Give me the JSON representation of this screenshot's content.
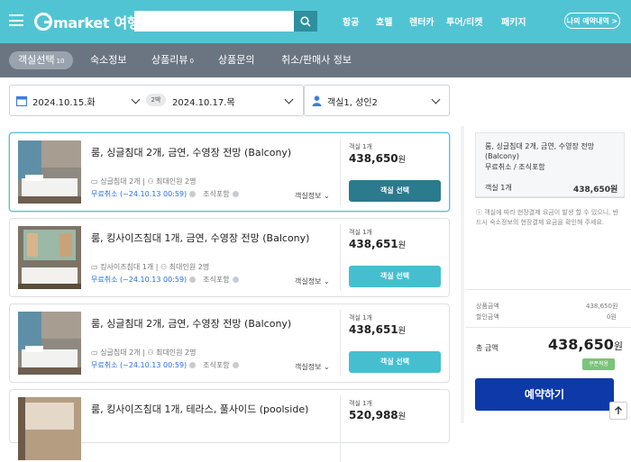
{
  "header": {
    "logo_text": "market 여행",
    "nav": [
      "항공",
      "호텔",
      "렌터카",
      "투어/티켓",
      "패키지"
    ],
    "my_button": "나의 예약내역 >"
  },
  "tabs": [
    {
      "label": "객실선택",
      "count": "10"
    },
    {
      "label": "숙소정보"
    },
    {
      "label": "상품리뷰",
      "count": "0"
    },
    {
      "label": "상품문의"
    },
    {
      "label": "취소/판매사 정보"
    }
  ],
  "filters": {
    "checkin": "2024.10.15.화",
    "nights": "2박",
    "checkout": "2024.10.17.목",
    "guests": "객실1, 성인2"
  },
  "rooms": [
    {
      "name": "룸, 싱글침대 2개, 금연, 수영장 전망 (Balcony)",
      "bed": "싱글침대 2개",
      "max": "최대인원 2명",
      "cancel": "무료취소 (~24.10.13 00:59)",
      "breakfast": "조식포함",
      "detail": "객실정보",
      "unit": "객실 1개",
      "price": "438,650",
      "won": "원",
      "button": "객실 선택"
    },
    {
      "name": "룸, 킹사이즈침대 1개, 금연, 수영장 전망 (Balcony)",
      "bed": "킹사이즈침대 1개",
      "max": "최대인원 2명",
      "cancel": "무료취소 (~24.10.13 00:59)",
      "breakfast": "조식포함",
      "detail": "객실정보",
      "unit": "객실 1개",
      "price": "438,651",
      "won": "원",
      "button": "객실 선택"
    },
    {
      "name": "룸, 싱글침대 2개, 금연, 수영장 전망 (Balcony)",
      "bed": "싱글침대 2개",
      "max": "최대인원 2명",
      "cancel": "무료취소 (~24.10.13 00:59)",
      "breakfast": "조식포함",
      "detail": "객실정보",
      "unit": "객실 1개",
      "price": "438,651",
      "won": "원",
      "button": "객실 선택"
    },
    {
      "name": "룸, 킹사이즈침대 1개, 테라스, 풀사이드 (poolside)",
      "unit": "객실 1개",
      "price": "520,988",
      "won": "원"
    }
  ],
  "summary": {
    "title": "룸, 싱글침대 2개, 금연, 수영장 전망 (Balcony)",
    "sub": "무료취소 / 조식포함",
    "qty_label": "객실 1개",
    "qty_price": "438,650원",
    "note": "객실에 따라 현장결제 요금이 발생 할 수 있으니, 반드시 숙소정보의 현장결제 요금을 확인해 주세요.",
    "product_label": "상품금액",
    "product_value": "438,650원",
    "discount_label": "할인금액",
    "discount_value": "0원",
    "total_label": "총 금액",
    "total_value": "438,650",
    "total_unit": "원",
    "coupon": "쿠폰적용",
    "book": "예약하기"
  }
}
